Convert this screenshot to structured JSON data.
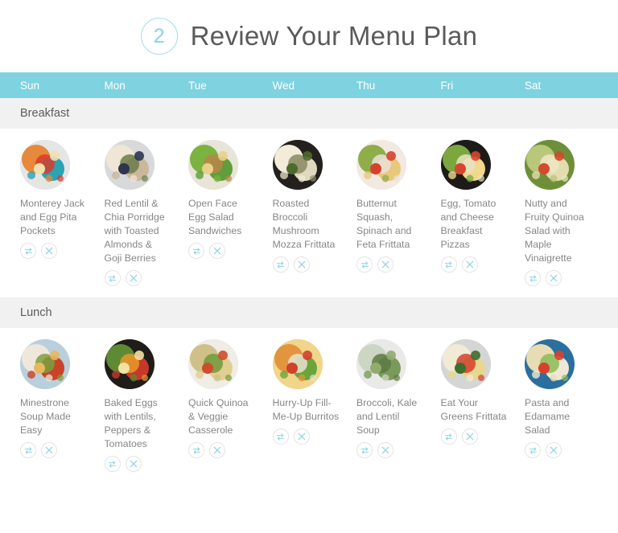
{
  "header": {
    "step_number": "2",
    "title": "Review Your Menu Plan"
  },
  "colors": {
    "weekday_bar": "#7fd2e0",
    "section_band": "#f1f1f1",
    "accent": "#8ad4e4",
    "meal_text": "#868686",
    "title_text": "#5a5a5a"
  },
  "weekdays": [
    {
      "label": "Sun"
    },
    {
      "label": "Mon"
    },
    {
      "label": "Tue"
    },
    {
      "label": "Wed"
    },
    {
      "label": "Thu"
    },
    {
      "label": "Fri"
    },
    {
      "label": "Sat"
    }
  ],
  "actions": {
    "swap_label": "swap-meal",
    "remove_label": "remove-meal"
  },
  "sections": [
    {
      "label": "Breakfast",
      "meals": [
        {
          "name": "Monterey Jack and Egg Pita Pockets",
          "image": "lunchbox-pita-apple-carrots"
        },
        {
          "name": "Red Lentil & Chia Porridge with Toasted Almonds & Goji Berries",
          "image": "porridge-bowls-blueberries"
        },
        {
          "name": "Open Face Egg Salad Sandwiches",
          "image": "egg-salad-open-sandwich-greens"
        },
        {
          "name": "Roasted Broccoli Mushroom Mozza Frittata",
          "image": "broccoli-mushroom-frittata-skillet"
        },
        {
          "name": "Butternut Squash, Spinach and Feta Frittata",
          "image": "frittata-slice-tomato-plate"
        },
        {
          "name": "Egg, Tomato and Cheese Breakfast Pizzas",
          "image": "breakfast-pizza-tray"
        },
        {
          "name": "Nutty and Fruity Quinoa Salad with Maple Vinaigrette",
          "image": "quinoa-salad-bowl"
        }
      ]
    },
    {
      "label": "Lunch",
      "meals": [
        {
          "name": "Minestrone Soup Made Easy",
          "image": "minestrone-soup-bowls-blue-napkin"
        },
        {
          "name": "Baked Eggs with Lentils, Peppers & Tomatoes",
          "image": "baked-eggs-skillet-peppers"
        },
        {
          "name": "Quick Quinoa & Veggie Casserole",
          "image": "quinoa-veggie-casserole-dish"
        },
        {
          "name": "Hurry-Up Fill-Me-Up Burritos",
          "image": "burrito-plate-salad-peppers"
        },
        {
          "name": "Broccoli, Kale and Lentil Soup",
          "image": "green-soup-white-pot"
        },
        {
          "name": "Eat Your Greens Frittata",
          "image": "greens-frittata-pan"
        },
        {
          "name": "Pasta and Edamame Salad",
          "image": "pasta-edamame-salad-blue-bowl"
        }
      ]
    }
  ]
}
